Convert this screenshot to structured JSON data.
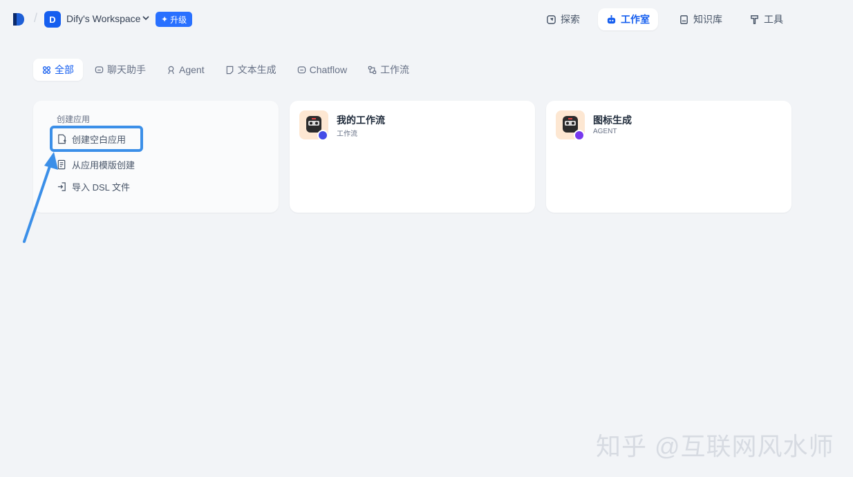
{
  "header": {
    "workspace_initial": "D",
    "workspace_name": "Dify's Workspace",
    "upgrade_label": "升级",
    "nav": [
      {
        "label": "探索",
        "icon": "compass-icon"
      },
      {
        "label": "工作室",
        "icon": "robot-icon",
        "active": true
      },
      {
        "label": "知识库",
        "icon": "book-icon"
      },
      {
        "label": "工具",
        "icon": "hammer-icon"
      }
    ]
  },
  "filter_tabs": [
    {
      "label": "全部",
      "icon": "grid-icon",
      "active": true
    },
    {
      "label": "聊天助手",
      "icon": "chat-icon"
    },
    {
      "label": "Agent",
      "icon": "agent-icon"
    },
    {
      "label": "文本生成",
      "icon": "text-icon"
    },
    {
      "label": "Chatflow",
      "icon": "chatflow-icon"
    },
    {
      "label": "工作流",
      "icon": "workflow-icon"
    }
  ],
  "create_card": {
    "title": "创建应用",
    "items": [
      {
        "label": "创建空白应用",
        "icon": "file-plus-icon"
      },
      {
        "label": "从应用模版创建",
        "icon": "template-icon"
      },
      {
        "label": "导入 DSL 文件",
        "icon": "import-icon"
      }
    ]
  },
  "apps": [
    {
      "name": "我的工作流",
      "type": "工作流",
      "badge_color": "#444ce7"
    },
    {
      "name": "图标生成",
      "type": "AGENT",
      "badge_color": "#7839ee"
    }
  ],
  "colors": {
    "accent": "#155eef",
    "annotation": "#3b8fe8"
  },
  "watermark": "知乎 @互联网风水师"
}
